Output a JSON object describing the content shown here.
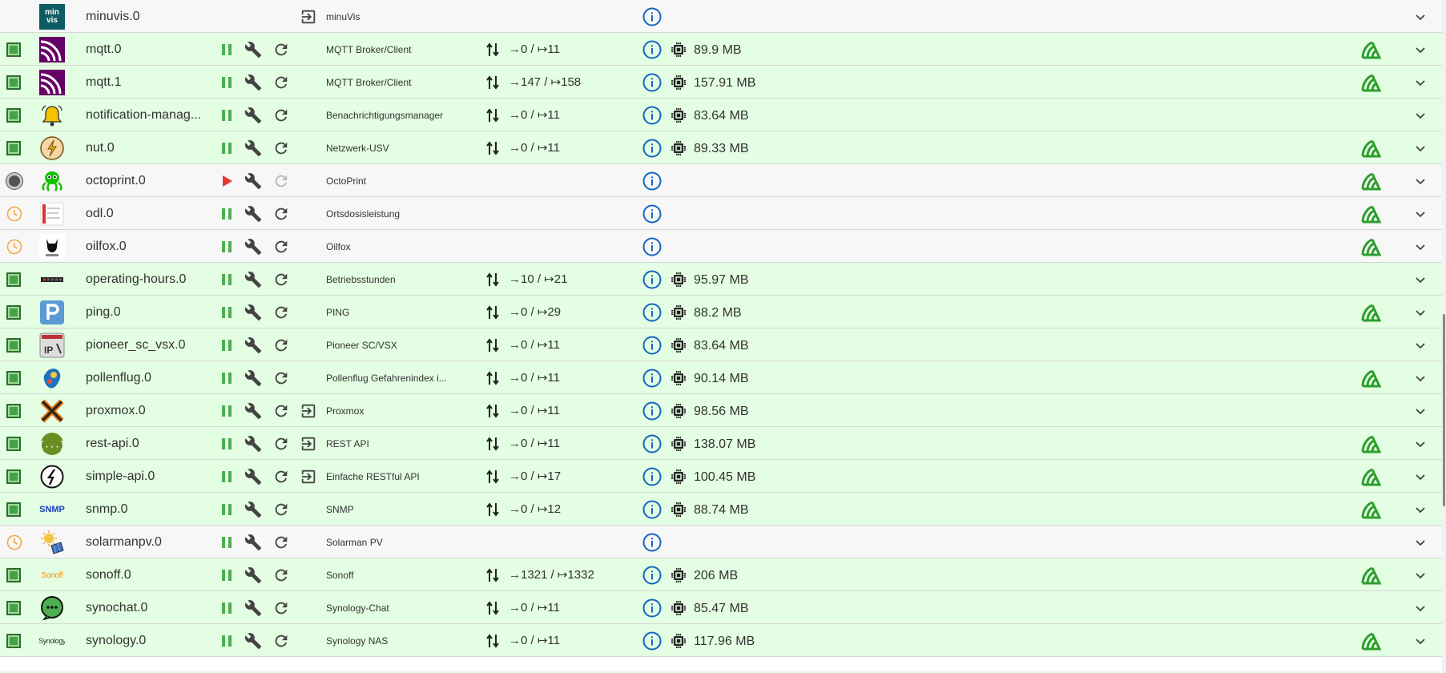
{
  "adapters": [
    {
      "name": "minuvis.0",
      "title": "minuVis",
      "status": "none",
      "running": false,
      "link": true,
      "events": "",
      "memory": "",
      "sentry": false,
      "logo": "minuvis-logo",
      "ctrls": false
    },
    {
      "name": "mqtt.0",
      "title": "MQTT Broker/Client",
      "status": "green",
      "running": true,
      "link": false,
      "events": "→0 / ↦11",
      "memory": "89.9 MB",
      "sentry": true,
      "logo": "mqtt-logo",
      "ctrls": true
    },
    {
      "name": "mqtt.1",
      "title": "MQTT Broker/Client",
      "status": "green",
      "running": true,
      "link": false,
      "events": "→147 / ↦158",
      "memory": "157.91 MB",
      "sentry": true,
      "logo": "mqtt-logo",
      "ctrls": true
    },
    {
      "name": "notification-manag...",
      "title": "Benachrichtigungsmanager",
      "status": "green",
      "running": true,
      "link": false,
      "events": "→0 / ↦11",
      "memory": "83.64 MB",
      "sentry": false,
      "logo": "bell-logo",
      "ctrls": true
    },
    {
      "name": "nut.0",
      "title": "Netzwerk-USV",
      "status": "green",
      "running": true,
      "link": false,
      "events": "→0 / ↦11",
      "memory": "89.33 MB",
      "sentry": true,
      "logo": "nut-logo",
      "ctrls": true
    },
    {
      "name": "octoprint.0",
      "title": "OctoPrint",
      "status": "stopped",
      "running": false,
      "link": false,
      "events": "",
      "memory": "",
      "sentry": true,
      "logo": "octoprint-logo",
      "ctrls": true
    },
    {
      "name": "odl.0",
      "title": "Ortsdosisleistung",
      "status": "clock",
      "running": true,
      "link": false,
      "events": "",
      "memory": "",
      "sentry": true,
      "logo": "odl-logo",
      "ctrls": true
    },
    {
      "name": "oilfox.0",
      "title": "Oilfox",
      "status": "clock",
      "running": true,
      "link": false,
      "events": "",
      "memory": "",
      "sentry": true,
      "logo": "oilfox-logo",
      "ctrls": true
    },
    {
      "name": "operating-hours.0",
      "title": "Betriebsstunden",
      "status": "green",
      "running": true,
      "link": false,
      "events": "→10 / ↦21",
      "memory": "95.97 MB",
      "sentry": false,
      "logo": "hours-logo",
      "ctrls": true
    },
    {
      "name": "ping.0",
      "title": "PING",
      "status": "green",
      "running": true,
      "link": false,
      "events": "→0 / ↦29",
      "memory": "88.2 MB",
      "sentry": true,
      "logo": "ping-logo",
      "ctrls": true
    },
    {
      "name": "pioneer_sc_vsx.0",
      "title": "Pioneer SC/VSX",
      "status": "green",
      "running": true,
      "link": false,
      "events": "→0 / ↦11",
      "memory": "83.64 MB",
      "sentry": false,
      "logo": "pioneer-logo",
      "ctrls": true
    },
    {
      "name": "pollenflug.0",
      "title": "Pollenflug Gefahrenindex i...",
      "status": "green",
      "running": true,
      "link": false,
      "events": "→0 / ↦11",
      "memory": "90.14 MB",
      "sentry": true,
      "logo": "pollen-logo",
      "ctrls": true
    },
    {
      "name": "proxmox.0",
      "title": "Proxmox",
      "status": "green",
      "running": true,
      "link": true,
      "events": "→0 / ↦11",
      "memory": "98.56 MB",
      "sentry": false,
      "logo": "proxmox-logo",
      "ctrls": true
    },
    {
      "name": "rest-api.0",
      "title": "REST API",
      "status": "green",
      "running": true,
      "link": true,
      "events": "→0 / ↦11",
      "memory": "138.07 MB",
      "sentry": true,
      "logo": "rest-logo",
      "ctrls": true
    },
    {
      "name": "simple-api.0",
      "title": "Einfache RESTful API",
      "status": "green",
      "running": true,
      "link": true,
      "events": "→0 / ↦17",
      "memory": "100.45 MB",
      "sentry": true,
      "logo": "simple-api-logo",
      "ctrls": true
    },
    {
      "name": "snmp.0",
      "title": "SNMP",
      "status": "green",
      "running": true,
      "link": false,
      "events": "→0 / ↦12",
      "memory": "88.74 MB",
      "sentry": true,
      "logo": "snmp-logo",
      "ctrls": true,
      "logo_text": "SNMP"
    },
    {
      "name": "solarmanpv.0",
      "title": "Solarman PV",
      "status": "clock",
      "running": true,
      "link": false,
      "events": "",
      "memory": "",
      "sentry": false,
      "logo": "solarman-logo",
      "ctrls": true
    },
    {
      "name": "sonoff.0",
      "title": "Sonoff",
      "status": "green",
      "running": true,
      "link": false,
      "events": "→1321 / ↦1332",
      "memory": "206 MB",
      "sentry": true,
      "logo": "sonoff-logo",
      "ctrls": true,
      "logo_text": "Sonoff"
    },
    {
      "name": "synochat.0",
      "title": "Synology-Chat",
      "status": "green",
      "running": true,
      "link": false,
      "events": "→0 / ↦11",
      "memory": "85.47 MB",
      "sentry": false,
      "logo": "synochat-logo",
      "ctrls": true
    },
    {
      "name": "synology.0",
      "title": "Synology NAS",
      "status": "green",
      "running": true,
      "link": false,
      "events": "→0 / ↦11",
      "memory": "117.96 MB",
      "sentry": true,
      "logo": "synology-logo",
      "ctrls": true,
      "logo_text": "Synology"
    }
  ],
  "colors": {
    "running_bg": "#e3fee2",
    "stopped_bg": "#f7f7f7",
    "pause": "#4caf50",
    "play": "#e53935",
    "info": "#1565c0",
    "sentry": "#2e9e2e",
    "clock": "#f4a742"
  },
  "minuvis_logo_text": "min vis"
}
